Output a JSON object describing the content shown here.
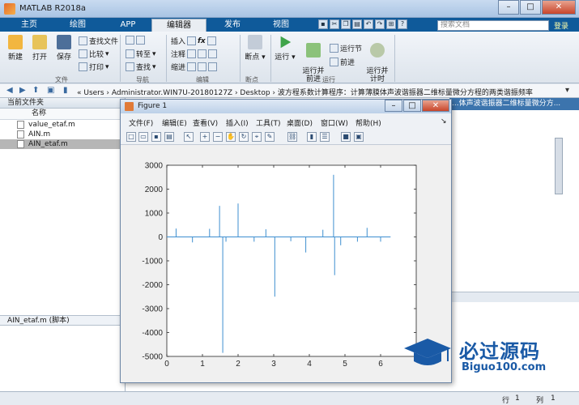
{
  "window": {
    "title": "MATLAB R2018a"
  },
  "ribbon_tabs": [
    {
      "label": "主页"
    },
    {
      "label": "绘图"
    },
    {
      "label": "APP"
    },
    {
      "label": "编辑器"
    },
    {
      "label": "发布"
    },
    {
      "label": "视图"
    }
  ],
  "search": {
    "placeholder": "搜索文档",
    "signin": "登录"
  },
  "ribbon": {
    "file": {
      "new": "新建",
      "open": "打开",
      "save": "保存",
      "find_files": "查找文件",
      "compare": "比较",
      "print": "打印",
      "group": "文件"
    },
    "navigate": {
      "goto": "转至",
      "find": "查找",
      "group": "导航"
    },
    "edit": {
      "insert": "插入",
      "comment": "注释",
      "indent": "缩进",
      "group": "编辑"
    },
    "breakpoints": {
      "label": "断点",
      "group": "断点"
    },
    "run": {
      "run": "运行",
      "run_advance": "运行并\n前进",
      "run_section": "运行节",
      "advance": "前进",
      "run_time": "运行并\n计时",
      "group": "运行"
    }
  },
  "address": {
    "path": "« Users › Administrator.WIN7U-20180127Z › Desktop › 波方程系数计算程序：计算薄膜体声波谐振器二维标量微分方程的两类谐振频率"
  },
  "current_folder": {
    "header": "当前文件夹",
    "column": "名称",
    "files": [
      {
        "name": "value_etaf.m"
      },
      {
        "name": "AIN.m"
      },
      {
        "name": "AIN_etaf.m"
      }
    ],
    "detail": "AIN_etaf.m  (脚本)"
  },
  "editor": {
    "tab_title": "...体声波谐振器二维标量微分方..."
  },
  "status": {
    "row_label": "行",
    "row": "1",
    "col_label": "列",
    "col": "1"
  },
  "figure": {
    "title": "Figure 1",
    "menu": [
      "文件(F)",
      "编辑(E)",
      "查看(V)",
      "插入(I)",
      "工具(T)",
      "桌面(D)",
      "窗口(W)",
      "帮助(H)"
    ]
  },
  "logo": {
    "brand": "必过源码",
    "site": "Biguo100.com"
  },
  "chart_data": {
    "type": "line",
    "xlim": [
      0,
      7
    ],
    "ylim": [
      -5000,
      3000
    ],
    "xticks": [
      0,
      1,
      2,
      3,
      4,
      5,
      6
    ],
    "yticks": [
      -5000,
      -4000,
      -3000,
      -2000,
      -1000,
      0,
      1000,
      2000,
      3000
    ],
    "series": [
      {
        "color": "#3e8fd0",
        "x_end": 6.28,
        "spikes": [
          {
            "x": 0.26,
            "y": 350
          },
          {
            "x": 0.72,
            "y": -230
          },
          {
            "x": 1.2,
            "y": 340
          },
          {
            "x": 1.48,
            "y": 1300
          },
          {
            "x": 1.57,
            "y": -4850
          },
          {
            "x": 1.66,
            "y": -200
          },
          {
            "x": 2.0,
            "y": 1400
          },
          {
            "x": 2.45,
            "y": -200
          },
          {
            "x": 2.78,
            "y": 320
          },
          {
            "x": 3.03,
            "y": -2500
          },
          {
            "x": 3.48,
            "y": -180
          },
          {
            "x": 3.9,
            "y": -650
          },
          {
            "x": 4.38,
            "y": 300
          },
          {
            "x": 4.68,
            "y": 2600
          },
          {
            "x": 4.71,
            "y": -1600
          },
          {
            "x": 4.88,
            "y": -350
          },
          {
            "x": 5.35,
            "y": -200
          },
          {
            "x": 5.62,
            "y": 380
          },
          {
            "x": 6.0,
            "y": -200
          }
        ]
      }
    ]
  }
}
